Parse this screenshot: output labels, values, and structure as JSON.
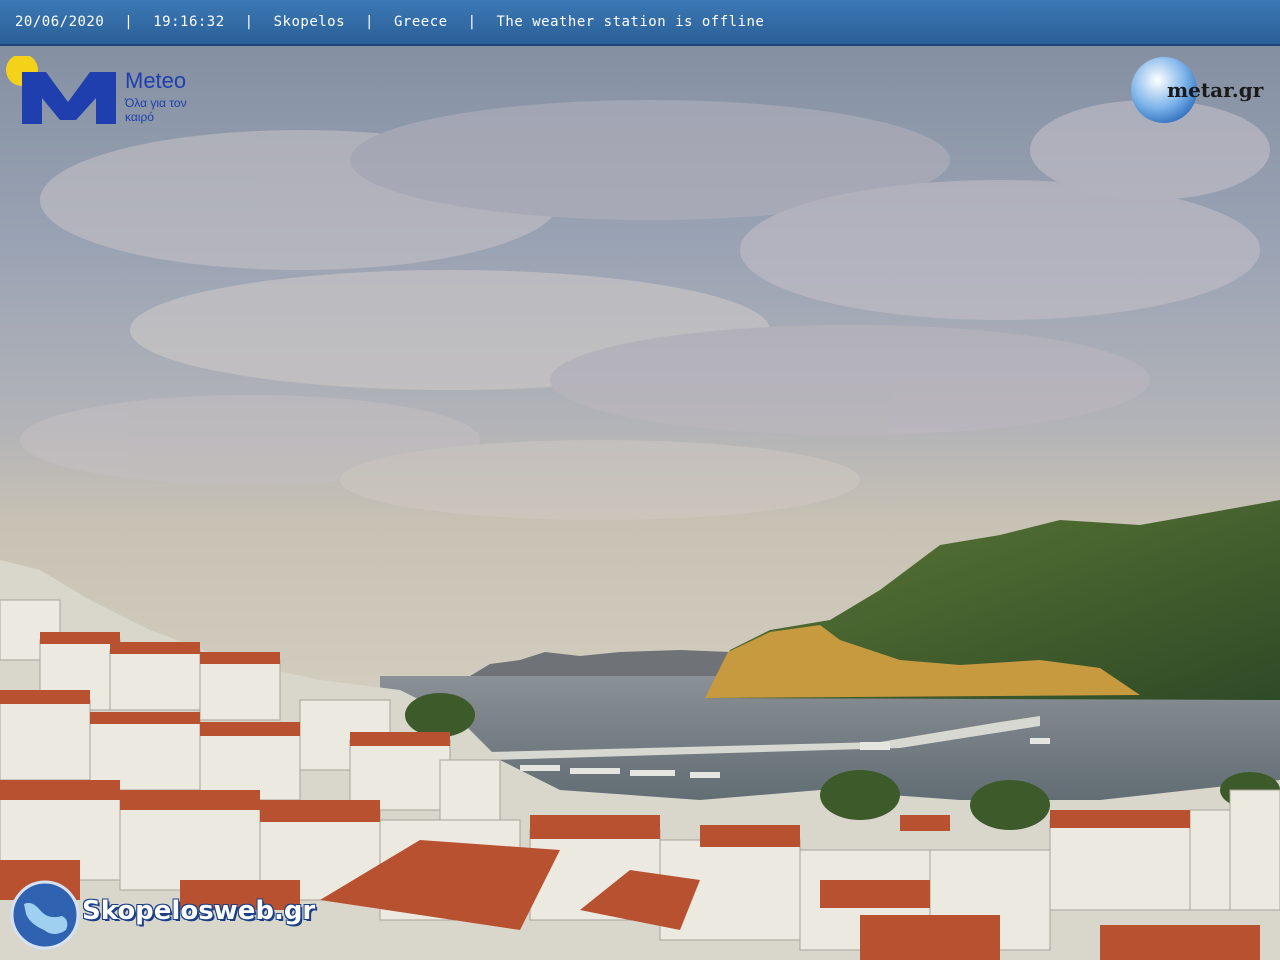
{
  "topbar": {
    "date": "20/06/2020",
    "time": "19:16:32",
    "location": "Skopelos",
    "country": "Greece",
    "status": "The weather station is offline",
    "separator": "|"
  },
  "meteo_logo": {
    "name": "Meteo",
    "tagline": "Όλα για τον καιρό",
    "brand_color": "#1f3fae",
    "sun_color": "#f5d21a"
  },
  "metar_logo": {
    "text": "metar.gr"
  },
  "skopelos_logo": {
    "text": "Skopelosweb.gr"
  },
  "colors": {
    "bar": "#3c79b5",
    "roofs": "#b8512f",
    "sea": "#5a6a72",
    "hill": "#4c6a2e"
  }
}
